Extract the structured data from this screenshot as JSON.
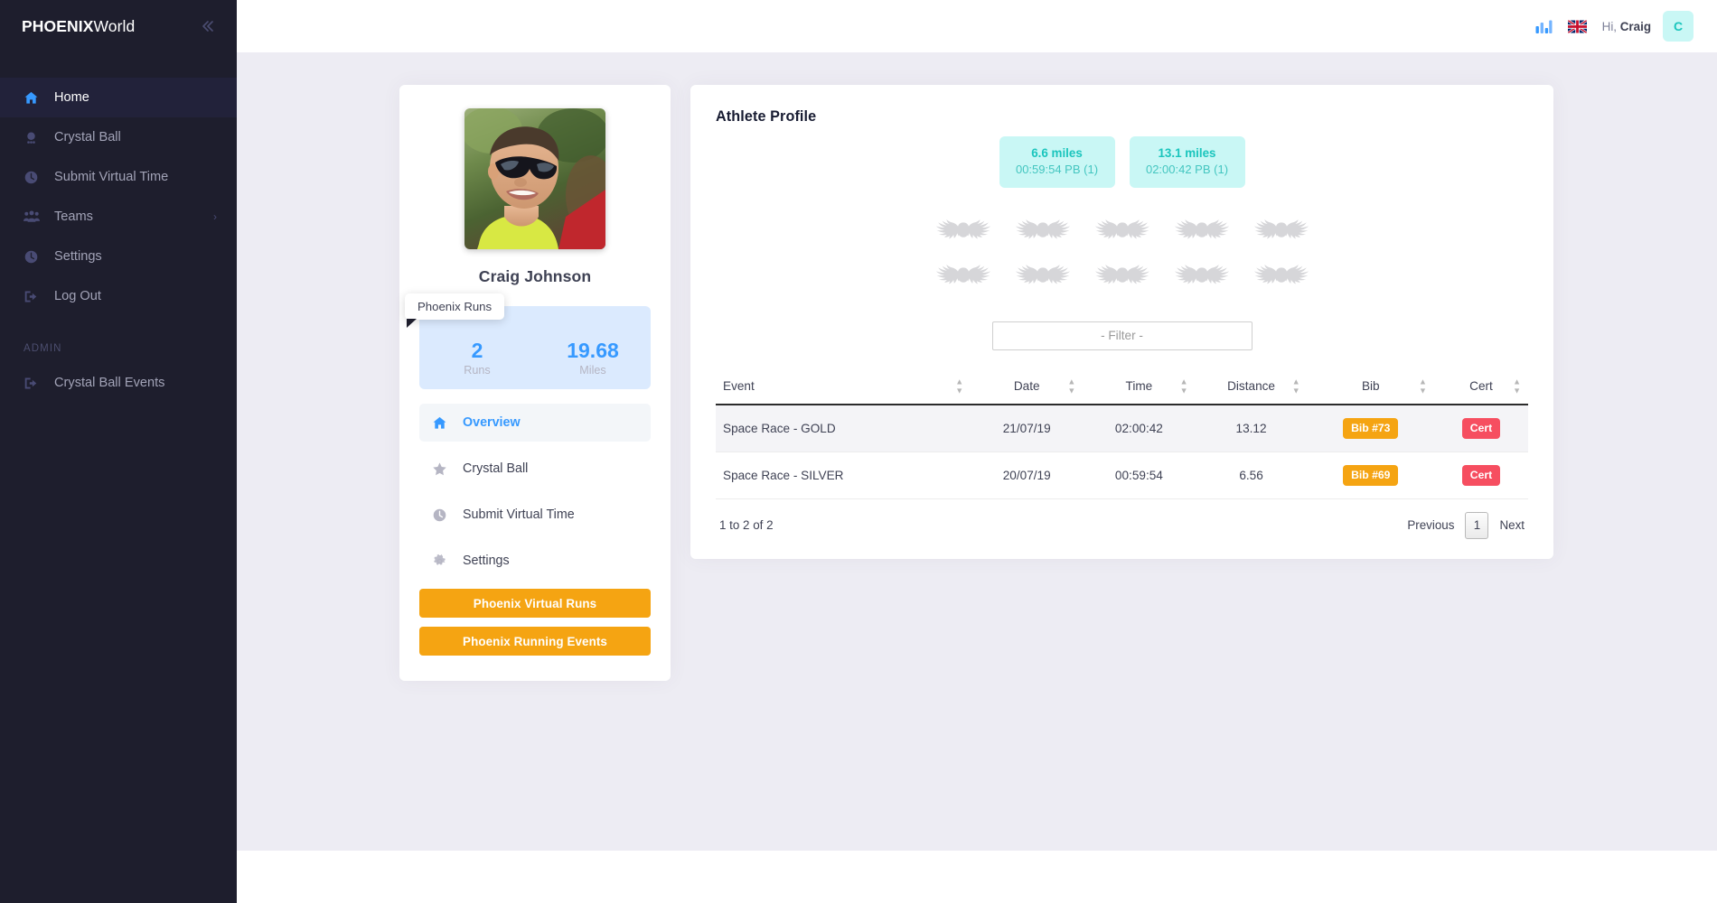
{
  "brand": {
    "bold": "PHOENIX",
    "light": "World",
    "collapse_icon": "chevrons-left-icon"
  },
  "sidebar": {
    "items": [
      {
        "label": "Home",
        "icon": "home-icon",
        "active": true
      },
      {
        "label": "Crystal Ball",
        "icon": "crystal-ball-icon",
        "active": false
      },
      {
        "label": "Submit Virtual Time",
        "icon": "clock-icon",
        "active": false
      },
      {
        "label": "Teams",
        "icon": "users-icon",
        "active": false,
        "arrow": "›"
      },
      {
        "label": "Settings",
        "icon": "clock-icon",
        "active": false
      },
      {
        "label": "Log Out",
        "icon": "logout-icon",
        "active": false
      }
    ],
    "section_label": "ADMIN",
    "admin_items": [
      {
        "label": "Crystal Ball Events",
        "icon": "logout-icon",
        "active": false
      }
    ]
  },
  "topbar": {
    "chart_icon": "bar-chart-icon",
    "flag_icon": "uk-flag-icon",
    "greeting_prefix": "Hi,",
    "greeting_name": "Craig",
    "avatar_initial": "C"
  },
  "profile": {
    "avatar_alt": "athlete-photo",
    "name": "Craig Johnson",
    "tooltip": "Phoenix Runs",
    "stats": [
      {
        "value": "2",
        "label": "Runs"
      },
      {
        "value": "19.68",
        "label": "Miles"
      }
    ],
    "menu": [
      {
        "label": "Overview",
        "icon": "home-icon",
        "active": true
      },
      {
        "label": "Crystal Ball",
        "icon": "star-icon",
        "active": false
      },
      {
        "label": "Submit Virtual Time",
        "icon": "clock-icon",
        "active": false
      },
      {
        "label": "Settings",
        "icon": "gear-icon",
        "active": false
      }
    ],
    "buttons": [
      {
        "label": "Phoenix Virtual Runs"
      },
      {
        "label": "Phoenix Running Events"
      }
    ]
  },
  "main": {
    "title": "Athlete Profile",
    "pb_badges": [
      {
        "distance": "6.6 miles",
        "time": "00:59:54 PB (1)"
      },
      {
        "distance": "13.1 miles",
        "time": "02:00:42 PB (1)"
      }
    ],
    "phoenix_badge_rows": 2,
    "phoenix_badges_per_row": 5,
    "phoenix_badge_icon": "phoenix-wings-icon",
    "filter_placeholder": "- Filter -",
    "filter_value": "",
    "table": {
      "columns": [
        "Event",
        "Date",
        "Time",
        "Distance",
        "Bib",
        "Cert"
      ],
      "rows": [
        {
          "event": "Space Race - GOLD",
          "date": "21/07/19",
          "time": "02:00:42",
          "distance": "13.12",
          "bib": "Bib #73",
          "cert": "Cert"
        },
        {
          "event": "Space Race - SILVER",
          "date": "20/07/19",
          "time": "00:59:54",
          "distance": "6.56",
          "bib": "Bib #69",
          "cert": "Cert"
        }
      ]
    },
    "pager": {
      "info": "1 to 2 of 2",
      "previous": "Previous",
      "page": "1",
      "next": "Next"
    }
  },
  "colors": {
    "sidebar_bg": "#1e1e2d",
    "accent_blue": "#3699ff",
    "accent_orange": "#f5a412",
    "accent_red": "#f64e60",
    "accent_teal": "#1bc5bd",
    "content_bg": "#edecf3"
  }
}
